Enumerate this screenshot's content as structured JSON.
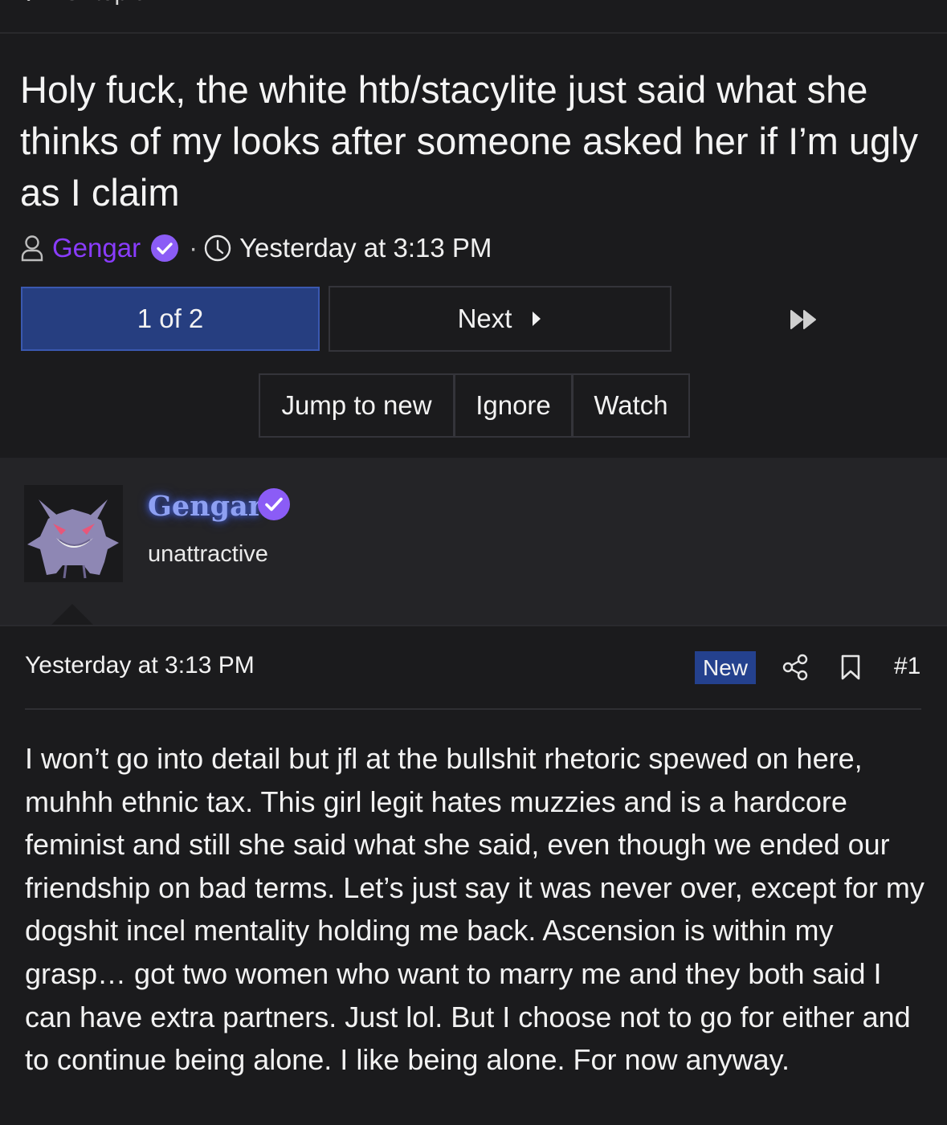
{
  "breadcrumb": {
    "back_glyph": "‹",
    "label": "Offtopic"
  },
  "thread": {
    "title": "Holy fuck, the white htb/stacylite just said what she thinks of my looks after someone asked her if I’m ugly as I claim",
    "author": "Gengar",
    "separator": "·",
    "time": "Yesterday at 3:13 PM"
  },
  "pagination": {
    "current": "1 of 2",
    "next_label": "Next"
  },
  "actions": {
    "jump_label": "Jump to new",
    "ignore_label": "Ignore",
    "watch_label": "Watch"
  },
  "post": {
    "username": "Gengar",
    "user_title": "unattractive",
    "date": "Yesterday at 3:13 PM",
    "badge": "New",
    "number": "#1",
    "body": "I won’t go into detail but jfl at the bullshit rhetoric spewed on here, muhhh ethnic tax. This girl legit hates muzzies and is a hardcore feminist and still she said what she said, even though we ended our friendship on bad terms. Let’s just say it was never over, except for my dogshit incel mentality holding me back. Ascension is within my grasp… got two women who want to marry me and they both said I can have extra partners. Just lol. But I choose not to go for either and to continue being alone. I like being alone. For now anyway."
  },
  "colors": {
    "background": "#1b1b1d",
    "author_link": "#8a3cff",
    "verified_badge": "#8b5cf6",
    "pager_current": "#263e80",
    "new_badge": "#24418e",
    "username_glow": "#8ea0f2"
  },
  "icons": {
    "user": "user-outline-icon",
    "verified": "verified-check-icon",
    "clock": "clock-icon",
    "next": "caret-right-icon",
    "last": "fast-forward-icon",
    "share": "share-icon",
    "bookmark": "bookmark-icon",
    "avatar": "gengar-avatar"
  }
}
